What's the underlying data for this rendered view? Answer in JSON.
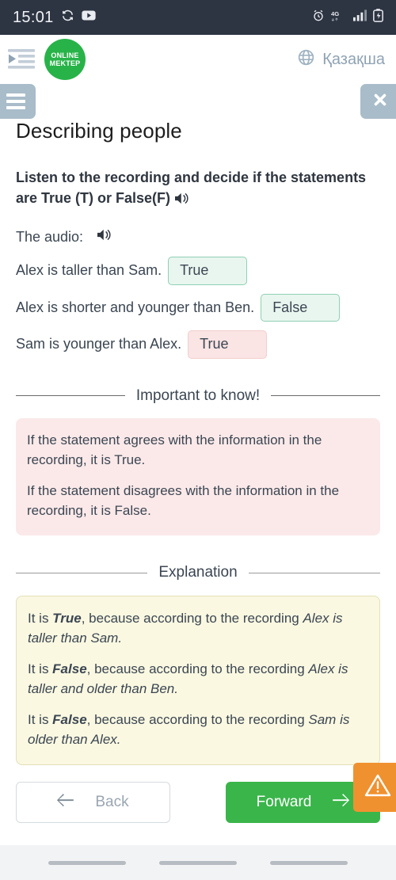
{
  "status_bar": {
    "time": "15:01",
    "left_icons": [
      "sync-icon",
      "youtube-icon"
    ],
    "right_icons": [
      "alarm-icon",
      "network-4g-icon",
      "signal-bars-icon",
      "battery-icon"
    ],
    "network_label": "4G"
  },
  "header": {
    "menu_icon": "indent-list-icon",
    "logo_line1": "ONLINE",
    "logo_line2": "MEKTEP",
    "logo_color": "#28b349",
    "language_icon": "globe-icon",
    "language_label": "Қазақша"
  },
  "controls": {
    "hamburger_icon": "hamburger-icon",
    "close_icon": "close-icon",
    "button_color": "#a8bcc9"
  },
  "page": {
    "title": "Describing people",
    "task_prompt": "Listen to the recording and decide if the statements are True (T) or False(F)",
    "audio_label": "The audio:",
    "speaker_icon": "speaker-icon"
  },
  "statements": [
    {
      "text": "Alex is taller than Sam.",
      "answer": "True",
      "state": "correct"
    },
    {
      "text": "Alex is shorter and younger than Ben.",
      "answer": "False",
      "state": "correct"
    },
    {
      "text": "Sam is younger than Alex.",
      "answer": "True",
      "state": "incorrect"
    }
  ],
  "important": {
    "divider_label": "Important to know!",
    "paragraphs": [
      "If the statement agrees with the information in the recording, it is True.",
      "If the statement disagrees with the information in the recording, it is False."
    ],
    "box_color": "#fbe9e9"
  },
  "explanation": {
    "divider_label": "Explanation",
    "items": [
      {
        "lead": "It is ",
        "verdict": "True",
        "middle": ", because according to the recording ",
        "quote": "Alex is taller than Sam."
      },
      {
        "lead": "It is ",
        "verdict": "False",
        "middle": ", because according to the recording ",
        "quote": "Alex is taller and older than Ben."
      },
      {
        "lead": "It is ",
        "verdict": "False",
        "middle": ", because according to the recording ",
        "quote": "Sam is older than Alex."
      }
    ],
    "box_color": "#faf8e1"
  },
  "footer": {
    "back_label": "Back",
    "back_icon": "arrow-left-icon",
    "forward_label": "Forward",
    "forward_icon": "arrow-right-icon",
    "forward_color": "#3ab54a",
    "warning_icon": "warning-triangle-icon",
    "warning_color": "#f0912f"
  },
  "nav_bar": {
    "buttons": [
      "recents-pill",
      "home-pill",
      "back-pill"
    ]
  }
}
